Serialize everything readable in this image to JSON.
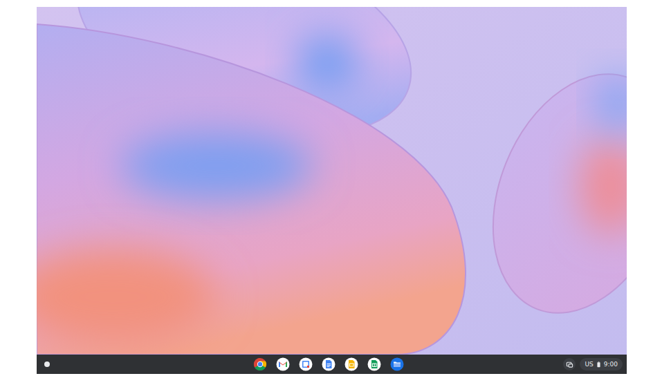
{
  "shelf": {
    "status_area": {
      "input_method": "US",
      "time": "9:00"
    }
  }
}
